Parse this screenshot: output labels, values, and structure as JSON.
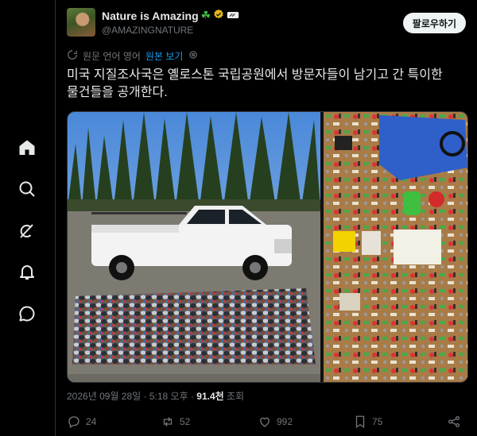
{
  "nav": [
    {
      "name": "home-icon"
    },
    {
      "name": "search-icon"
    },
    {
      "name": "grok-icon"
    },
    {
      "name": "bell-icon"
    },
    {
      "name": "messages-icon"
    }
  ],
  "author": {
    "display_name": "Nature is Amazing",
    "handle": "@AMAZINGNATURE",
    "badges": [
      "shamrock-icon",
      "verified-icon",
      "affiliate-icon"
    ]
  },
  "follow_label": "팔로우하기",
  "translate": {
    "note": "원문 언어 영어",
    "show_original": "원본 보기"
  },
  "tweet_text": "미국 지질조사국은 옐로스톤 국립공원에서 방문자들이 남기고 간 특이한\n물건들을 공개한다.",
  "meta": {
    "timestamp": "2026년 09월 28일 · 5:18 오후 · ",
    "views": "91.4천",
    "views_label": " 조회"
  },
  "actions": {
    "replies": "24",
    "reposts": "52",
    "likes": "992",
    "bookmarks": "75"
  },
  "colors": {
    "background": "#000000",
    "text": "#e7e9ea",
    "muted": "#71767b",
    "link": "#1d9bf0",
    "verified": "#e2b719"
  }
}
